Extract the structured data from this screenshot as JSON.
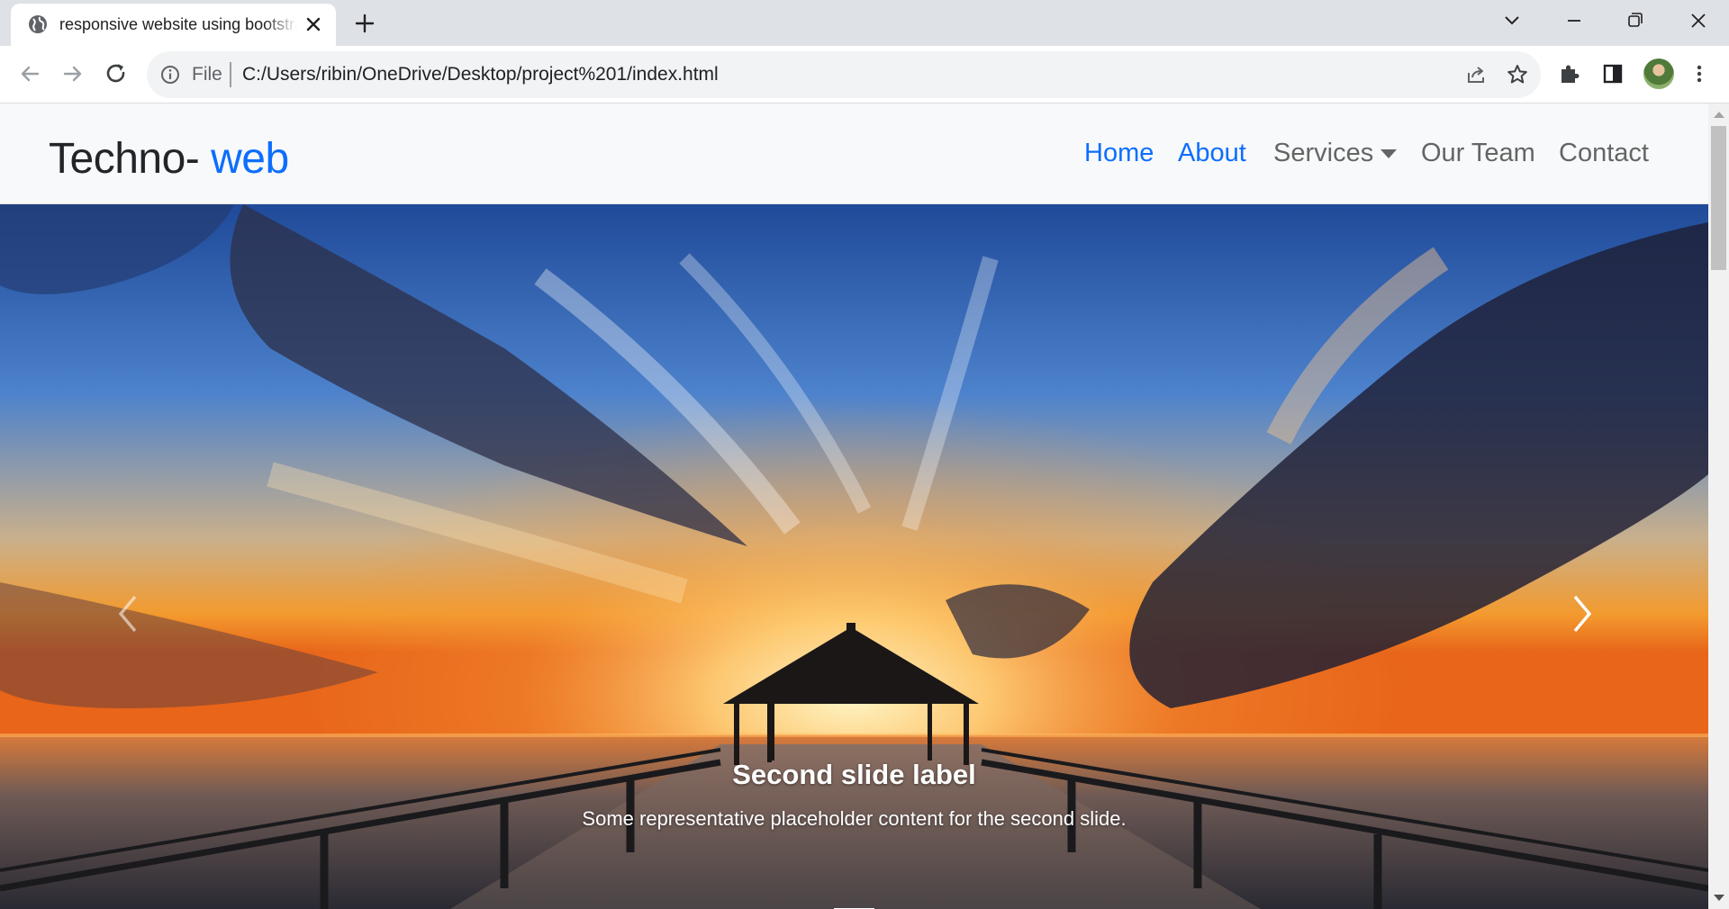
{
  "browser": {
    "tab": {
      "title": "responsive website using bootstrap",
      "favicon": "globe-icon"
    },
    "new_tab_icon": "plus-icon",
    "window_controls": [
      "tab-search-icon",
      "minimize-icon",
      "restore-icon",
      "close-icon"
    ],
    "address_bar": {
      "scheme_label": "File",
      "url": "C:/Users/ribin/OneDrive/Desktop/project%201/index.html"
    }
  },
  "site": {
    "brand": {
      "primary": "Techno- ",
      "accent": "web"
    },
    "nav": {
      "home": "Home",
      "about": "About",
      "services": "Services",
      "our_team": "Our Team",
      "contact": "Contact"
    },
    "carousel": {
      "slide_label": "Second slide label",
      "slide_text": "Some representative placeholder content for the second slide.",
      "slide_count": 3,
      "active_index": 1
    }
  },
  "colors": {
    "accent": "#0d6efd",
    "navbar_bg": "#f8f9fa",
    "tabstrip_bg": "#dee1e6"
  }
}
